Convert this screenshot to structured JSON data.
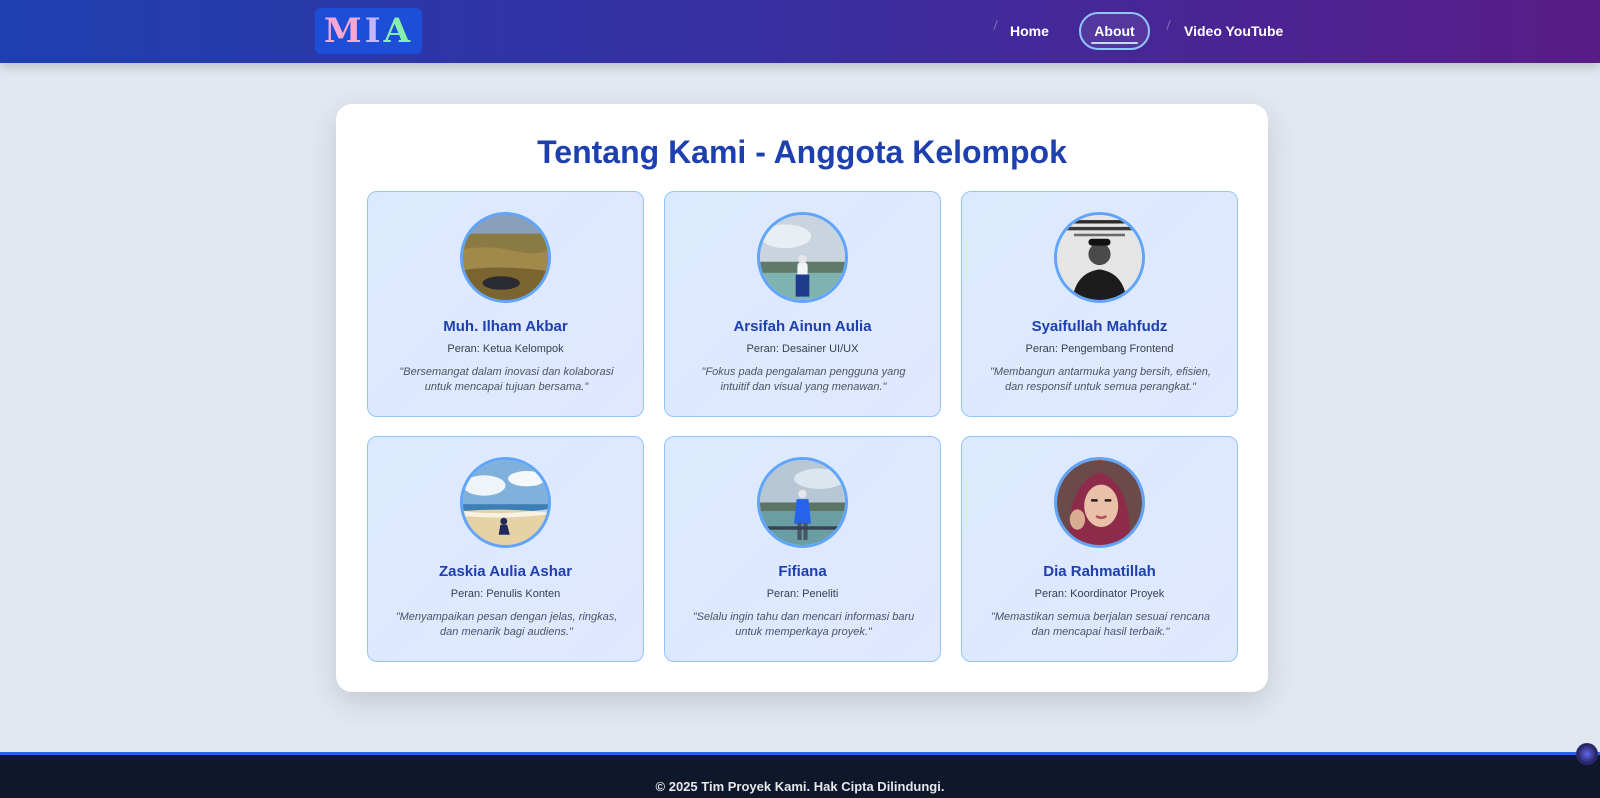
{
  "navbar": {
    "logo": {
      "letters": [
        "M",
        "I",
        "A"
      ]
    },
    "items": [
      {
        "label": "Home"
      },
      {
        "label": "About",
        "active": true
      },
      {
        "label": "Video YouTube"
      }
    ]
  },
  "main": {
    "title": "Tentang Kami - Anggota Kelompok",
    "members": [
      {
        "name": "Muh. Ilham Akbar",
        "role": "Peran: Ketua Kelompok",
        "quote": "\"Bersemangat dalam inovasi dan kolaborasi untuk mencapai tujuan bersama.\""
      },
      {
        "name": "Arsifah Ainun Aulia",
        "role": "Peran: Desainer UI/UX",
        "quote": "\"Fokus pada pengalaman pengguna yang intuitif dan visual yang menawan.\""
      },
      {
        "name": "Syaifullah Mahfudz",
        "role": "Peran: Pengembang Frontend",
        "quote": "\"Membangun antarmuka yang bersih, efisien, dan responsif untuk semua perangkat.\""
      },
      {
        "name": "Zaskia Aulia Ashar",
        "role": "Peran: Penulis Konten",
        "quote": "\"Menyampaikan pesan dengan jelas, ringkas, dan menarik bagi audiens.\""
      },
      {
        "name": "Fifiana",
        "role": "Peran: Peneliti",
        "quote": "\"Selalu ingin tahu dan mencari informasi baru untuk memperkaya proyek.\""
      },
      {
        "name": "Dia Rahmatillah",
        "role": "Peran: Koordinator Proyek",
        "quote": "\"Memastikan semua berjalan sesuai rencana dan mencapai hasil terbaik.\""
      }
    ]
  },
  "footer": {
    "text": "© 2025 Tim Proyek Kami. Hak Cipta Dilindungi."
  },
  "colors": {
    "accent": "#1e40af",
    "navbar_start": "#1e40af",
    "navbar_end": "#581c87",
    "card_border": "#93c5fd",
    "footer_bg": "#0f172a"
  }
}
